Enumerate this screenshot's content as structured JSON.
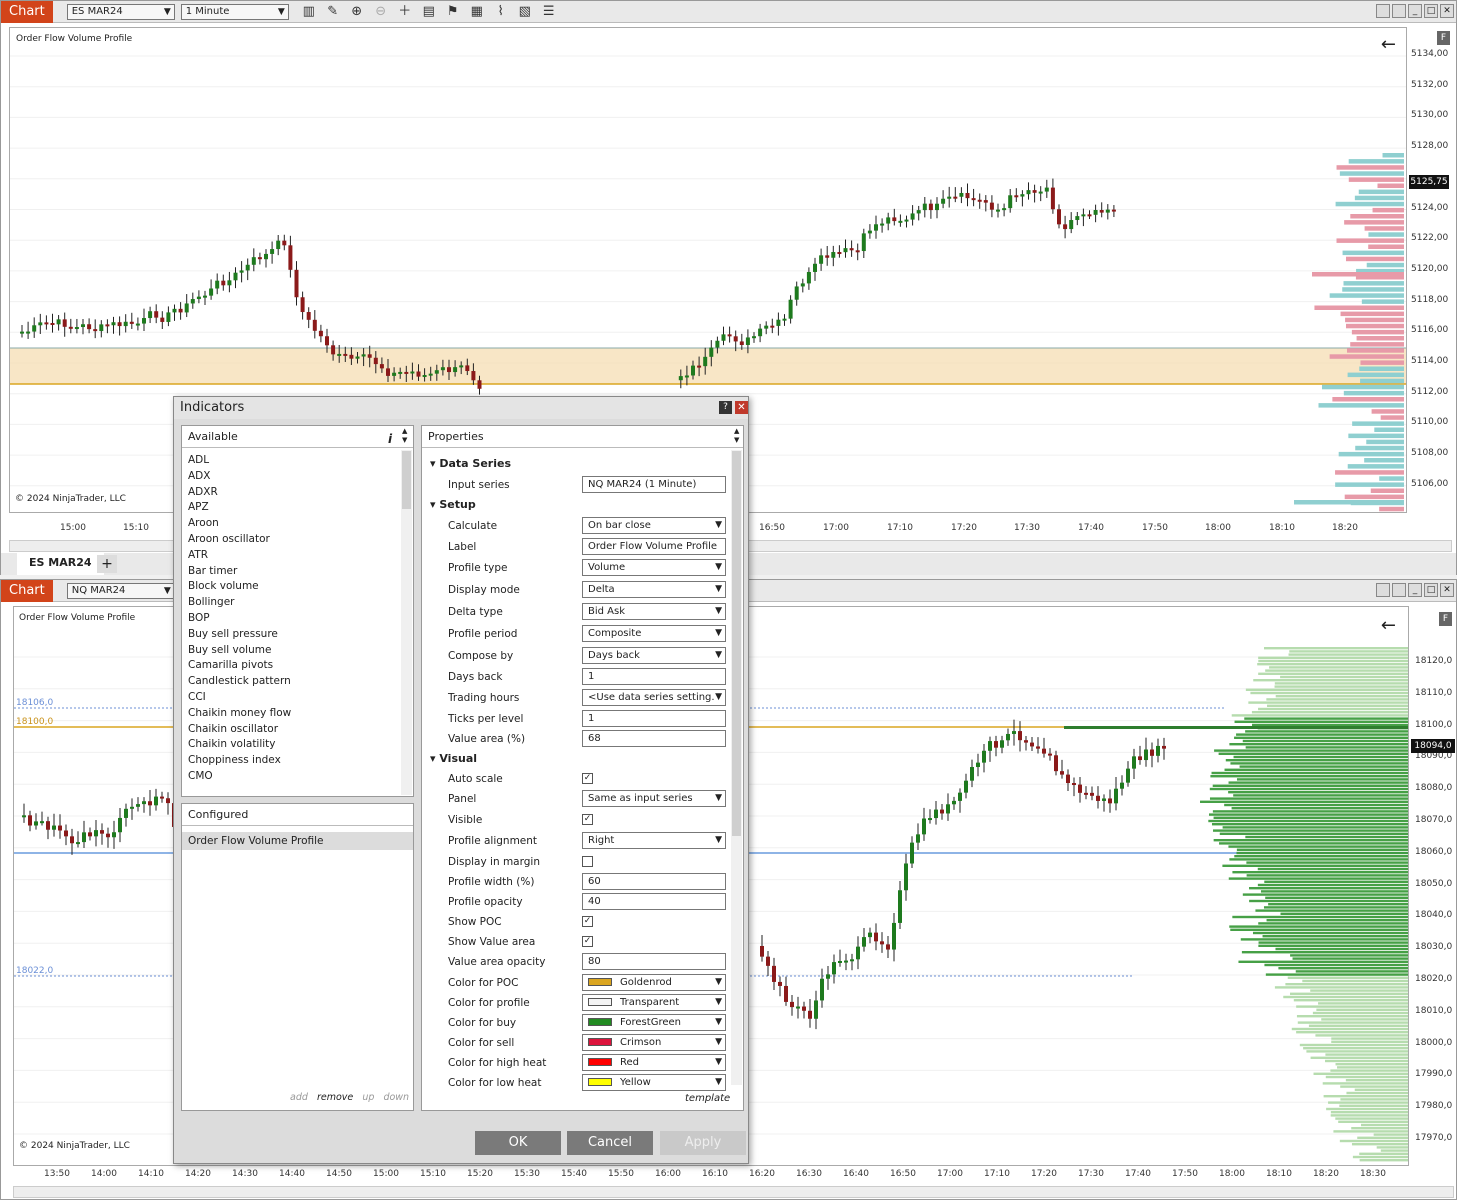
{
  "top_chart": {
    "tag": "Chart",
    "instrument": "ES MAR24",
    "timeframe": "1 Minute",
    "indicator_label": "Order Flow Volume Profile",
    "copyright": "© 2024 NinjaTrader, LLC",
    "current_price": "5125,75",
    "prices": [
      "5134,00",
      "5132,00",
      "5130,00",
      "5128,00",
      "5124,00",
      "5122,00",
      "5120,00",
      "5118,00",
      "5116,00",
      "5114,00",
      "5112,00",
      "5110,00",
      "5108,00",
      "5106,00"
    ],
    "times": [
      "15:00",
      "15:10",
      "16:50",
      "17:00",
      "17:10",
      "17:20",
      "17:30",
      "17:40",
      "17:50",
      "18:00",
      "18:10",
      "18:20"
    ],
    "tab": "ES MAR24"
  },
  "bottom_chart": {
    "tag": "Chart",
    "instrument": "NQ MAR24",
    "indicator_label": "Order Flow Volume Profile",
    "copyright": "© 2024 NinjaTrader, LLC",
    "current_price": "18094,0",
    "level_labels": [
      "18106,0",
      "18100,0",
      "18022,0"
    ],
    "prices": [
      "18120,0",
      "18110,0",
      "18100,0",
      "18090,0",
      "18080,0",
      "18070,0",
      "18060,0",
      "18050,0",
      "18040,0",
      "18030,0",
      "18020,0",
      "18010,0",
      "18000,0",
      "17990,0",
      "17980,0",
      "17970,0"
    ],
    "times": [
      "13:50",
      "14:00",
      "14:10",
      "14:20",
      "14:30",
      "14:40",
      "14:50",
      "15:00",
      "15:10",
      "15:20",
      "15:30",
      "15:40",
      "15:50",
      "16:00",
      "16:10",
      "16:20",
      "16:30",
      "16:40",
      "16:50",
      "17:00",
      "17:10",
      "17:20",
      "17:30",
      "17:40",
      "17:50",
      "18:00",
      "18:10",
      "18:20",
      "18:30"
    ]
  },
  "dialog": {
    "title": "Indicators",
    "available_header": "Available",
    "available": [
      "ADL",
      "ADX",
      "ADXR",
      "APZ",
      "Aroon",
      "Aroon oscillator",
      "ATR",
      "Bar timer",
      "Block volume",
      "Bollinger",
      "BOP",
      "Buy sell pressure",
      "Buy sell volume",
      "Camarilla pivots",
      "Candlestick pattern",
      "CCI",
      "Chaikin money flow",
      "Chaikin oscillator",
      "Chaikin volatility",
      "Choppiness index",
      "CMO"
    ],
    "configured_header": "Configured",
    "configured": [
      "Order Flow Volume Profile"
    ],
    "list_actions": [
      "add",
      "remove",
      "up",
      "down"
    ],
    "properties_header": "Properties",
    "sections": {
      "data_series": "Data Series",
      "setup": "Setup",
      "visual": "Visual"
    },
    "props": {
      "input_series": {
        "label": "Input series",
        "value": "NQ MAR24 (1 Minute)"
      },
      "calculate": {
        "label": "Calculate",
        "value": "On bar close"
      },
      "label": {
        "label": "Label",
        "value": "Order Flow Volume Profile"
      },
      "profile_type": {
        "label": "Profile type",
        "value": "Volume"
      },
      "display_mode": {
        "label": "Display mode",
        "value": "Delta"
      },
      "delta_type": {
        "label": "Delta type",
        "value": "Bid Ask"
      },
      "profile_period": {
        "label": "Profile period",
        "value": "Composite"
      },
      "compose_by": {
        "label": "Compose by",
        "value": "Days back"
      },
      "days_back": {
        "label": "Days back",
        "value": "1"
      },
      "trading_hours": {
        "label": "Trading hours",
        "value": "<Use data series setting..."
      },
      "ticks_per_level": {
        "label": "Ticks per level",
        "value": "1"
      },
      "value_area": {
        "label": "Value area (%)",
        "value": "68"
      },
      "auto_scale": {
        "label": "Auto scale"
      },
      "panel": {
        "label": "Panel",
        "value": "Same as input series"
      },
      "visible": {
        "label": "Visible"
      },
      "profile_alignment": {
        "label": "Profile alignment",
        "value": "Right"
      },
      "display_in_margin": {
        "label": "Display in margin"
      },
      "profile_width": {
        "label": "Profile width (%)",
        "value": "60"
      },
      "profile_opacity": {
        "label": "Profile opacity",
        "value": "40"
      },
      "show_poc": {
        "label": "Show POC"
      },
      "show_value_area": {
        "label": "Show Value area"
      },
      "value_area_opacity": {
        "label": "Value area opacity",
        "value": "80"
      },
      "color_poc": {
        "label": "Color for POC",
        "value": "Goldenrod",
        "color": "#daa520"
      },
      "color_profile": {
        "label": "Color for profile",
        "value": "Transparent",
        "color": "#f4f4f4"
      },
      "color_buy": {
        "label": "Color for buy",
        "value": "ForestGreen",
        "color": "#228b22"
      },
      "color_sell": {
        "label": "Color for sell",
        "value": "Crimson",
        "color": "#dc143c"
      },
      "color_high_heat": {
        "label": "Color for high heat",
        "value": "Red",
        "color": "#ff0000"
      },
      "color_low_heat": {
        "label": "Color for low heat",
        "value": "Yellow",
        "color": "#ffff00"
      }
    },
    "template_link": "template",
    "ok": "OK",
    "cancel": "Cancel",
    "apply": "Apply"
  }
}
